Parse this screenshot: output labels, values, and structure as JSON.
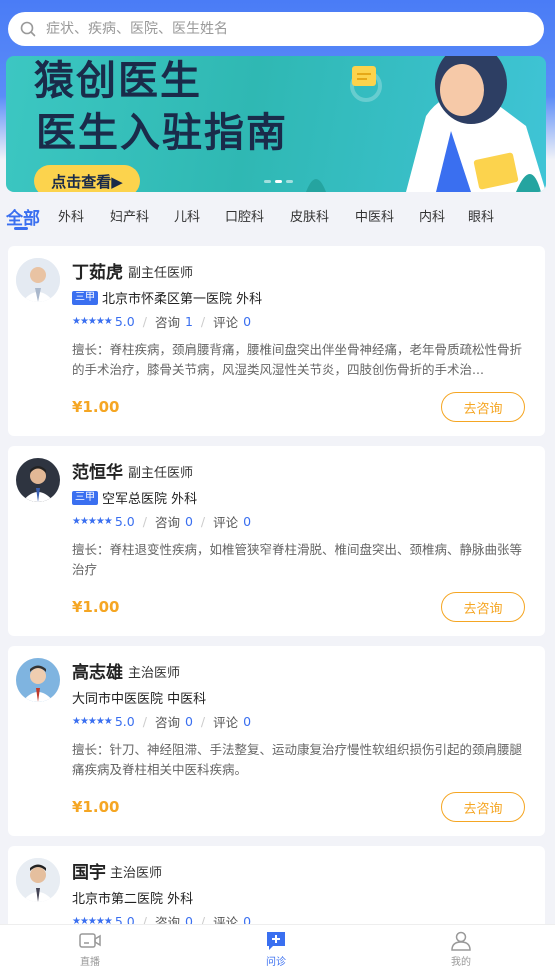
{
  "search": {
    "placeholder": "症状、疾病、医院、医生姓名"
  },
  "banner": {
    "title_line1": "猿创医生",
    "title_line2": "医生入驻指南",
    "cta": "点击查看▶"
  },
  "tabs": [
    "全部",
    "外科",
    "妇产科",
    "儿科",
    "口腔科",
    "皮肤科",
    "中医科",
    "内科",
    "眼科"
  ],
  "doctors": [
    {
      "name": "丁茹虎",
      "title": "副主任医师",
      "badge": "三甲",
      "hospital": "北京市怀柔区第一医院",
      "dept": "外科",
      "stars": "★★★★★",
      "rating": "5.0",
      "consult_label": "咨询",
      "consult": "1",
      "review_label": "评论",
      "review": "0",
      "desc": "擅长：脊柱疾病，颈肩腰背痛，腰椎间盘突出伴坐骨神经痛，老年骨质疏松性骨折的手术治疗，膝骨关节病，风湿类风湿性关节炎，四肢创伤骨折的手术治...",
      "price": "¥1.00",
      "button": "去咨询"
    },
    {
      "name": "范恒华",
      "title": "副主任医师",
      "badge": "三甲",
      "hospital": "空军总医院",
      "dept": "外科",
      "stars": "★★★★★",
      "rating": "5.0",
      "consult_label": "咨询",
      "consult": "0",
      "review_label": "评论",
      "review": "0",
      "desc": "擅长：脊柱退变性疾病，如椎管狭窄脊柱滑脱、椎间盘突出、颈椎病、静脉曲张等治疗",
      "price": "¥1.00",
      "button": "去咨询"
    },
    {
      "name": "高志雄",
      "title": "主治医师",
      "badge": "",
      "hospital": "大同市中医医院",
      "dept": "中医科",
      "stars": "★★★★★",
      "rating": "5.0",
      "consult_label": "咨询",
      "consult": "0",
      "review_label": "评论",
      "review": "0",
      "desc": "擅长：针刀、神经阻滞、手法整复、运动康复治疗慢性软组织损伤引起的颈肩腰腿痛疾病及脊柱相关中医科疾病。",
      "price": "¥1.00",
      "button": "去咨询"
    },
    {
      "name": "国宇",
      "title": "主治医师",
      "badge": "",
      "hospital": "北京市第二医院",
      "dept": "外科",
      "stars": "★★★★★",
      "rating": "5.0",
      "consult_label": "咨询",
      "consult": "0",
      "review_label": "评论",
      "review": "0",
      "desc": "",
      "price": "",
      "button": ""
    }
  ],
  "tabbar": [
    {
      "label": "直播",
      "icon": "live-icon",
      "active": false
    },
    {
      "label": "问诊",
      "icon": "consult-icon",
      "active": true
    },
    {
      "label": "我的",
      "icon": "profile-icon",
      "active": false
    }
  ],
  "colors": {
    "accent": "#3a6ff0",
    "price": "#f5a623",
    "banner": "#2fb8b3"
  }
}
